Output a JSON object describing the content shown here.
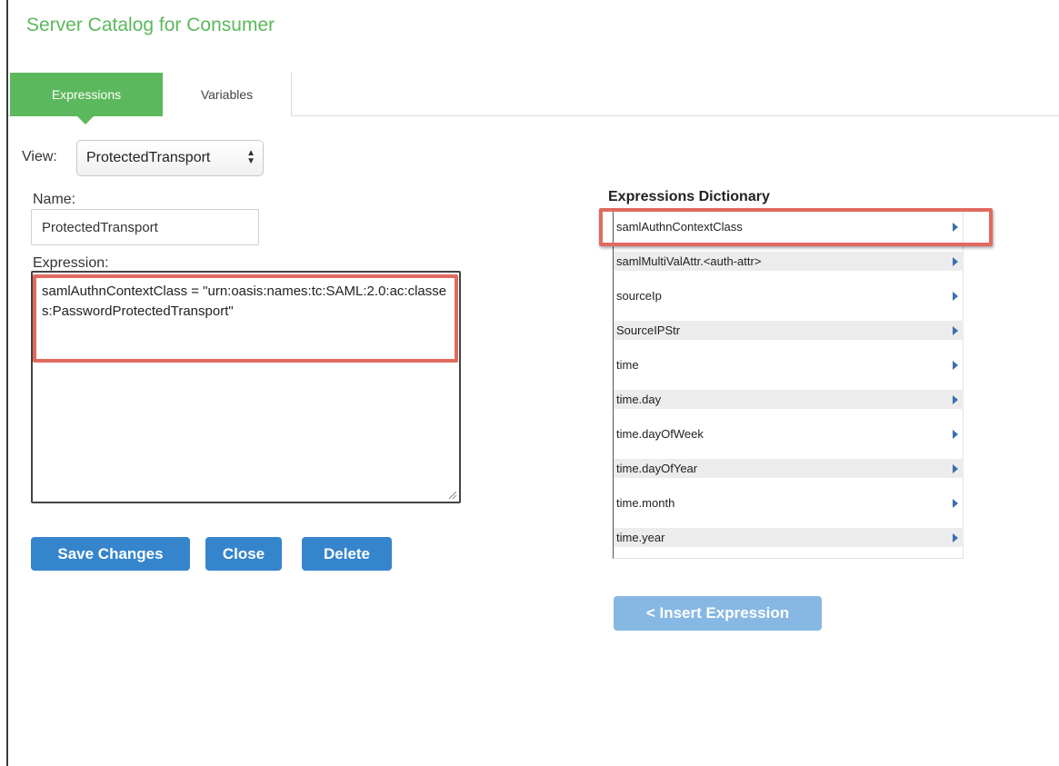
{
  "page_title": "Server Catalog for Consumer",
  "tabs": [
    {
      "label": "Expressions",
      "active": true
    },
    {
      "label": "Variables",
      "active": false
    }
  ],
  "view": {
    "label": "View:",
    "selected": "ProtectedTransport"
  },
  "form": {
    "name_label": "Name:",
    "name_value": "ProtectedTransport",
    "expression_label": "Expression:",
    "expression_value": "samlAuthnContextClass = \"urn:oasis:names:tc:SAML:2.0:ac:classes:PasswordProtectedTransport\""
  },
  "buttons": {
    "save": "Save Changes",
    "close": "Close",
    "delete": "Delete",
    "insert": "< Insert Expression"
  },
  "dictionary": {
    "title": "Expressions Dictionary",
    "items": [
      "samlAuthnContextClass",
      "samlMultiValAttr.<auth-attr>",
      "sourceIp",
      "SourceIPStr",
      "time",
      "time.day",
      "time.dayOfWeek",
      "time.dayOfYear",
      "time.month",
      "time.year"
    ]
  },
  "colors": {
    "accent_green": "#5cb85c",
    "primary_blue": "#3585cc",
    "disabled_blue": "#87b8e4",
    "highlight_red": "#e06a5f"
  }
}
